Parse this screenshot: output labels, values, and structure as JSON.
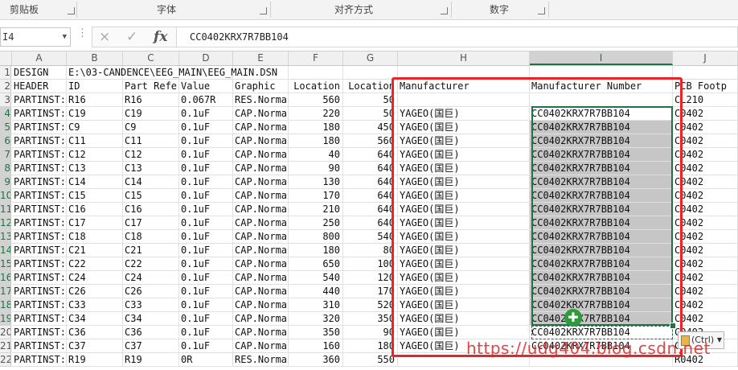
{
  "ribbon": {
    "groups": [
      "剪贴板",
      "字体",
      "对齐方式",
      "数字"
    ]
  },
  "formula_bar": {
    "name_box": "I4",
    "cancel_icon": "×",
    "enter_icon": "✓",
    "fx_label": "fx",
    "formula": "CC0402KRX7R7BB104"
  },
  "columns": [
    "A",
    "B",
    "C",
    "D",
    "E",
    "F",
    "G",
    "H",
    "I",
    "J"
  ],
  "rows": [
    {
      "num": "1",
      "A": "DESIGN",
      "B": "E:\\03-CANDENCE\\EEG_MAIN\\EEG_MAIN.DSN",
      "C": "",
      "D": "",
      "E": "",
      "F": "",
      "G": "",
      "H": "",
      "I": "",
      "J": ""
    },
    {
      "num": "2",
      "A": "HEADER",
      "B": "ID",
      "C": "Part Refe",
      "D": "Value",
      "E": "Graphic",
      "F": "Location",
      "G": "Location",
      "H": "Manufacturer",
      "I": "Manufacturer Number",
      "J": "PCB Footp"
    },
    {
      "num": "3",
      "A": "PARTINST:R16",
      "B": "R16",
      "C": "R16",
      "D": "0.067R",
      "E": "RES.Norma",
      "F": "560",
      "G": "50",
      "H": "",
      "I": "",
      "J": "CL210"
    },
    {
      "num": "4",
      "A": "PARTINST:C19",
      "B": "C19",
      "C": "C19",
      "D": "0.1uF",
      "E": "CAP.Norma",
      "F": "220",
      "G": "50",
      "H": "YAGEO(国巨)",
      "I": "CC0402KRX7R7BB104",
      "J": "C0402"
    },
    {
      "num": "5",
      "A": "PARTINST:C9",
      "B": "C9",
      "C": "C9",
      "D": "0.1uF",
      "E": "CAP.Norma",
      "F": "180",
      "G": "450",
      "H": "YAGEO(国巨)",
      "I": "CC0402KRX7R7BB104",
      "J": "C0402"
    },
    {
      "num": "6",
      "A": "PARTINST:C11",
      "B": "C11",
      "C": "C11",
      "D": "0.1uF",
      "E": "CAP.Norma",
      "F": "180",
      "G": "560",
      "H": "YAGEO(国巨)",
      "I": "CC0402KRX7R7BB104",
      "J": "C0402"
    },
    {
      "num": "7",
      "A": "PARTINST:C12",
      "B": "C12",
      "C": "C12",
      "D": "0.1uF",
      "E": "CAP.Norma",
      "F": "40",
      "G": "640",
      "H": "YAGEO(国巨)",
      "I": "CC0402KRX7R7BB104",
      "J": "C0402"
    },
    {
      "num": "8",
      "A": "PARTINST:C13",
      "B": "C13",
      "C": "C13",
      "D": "0.1uF",
      "E": "CAP.Norma",
      "F": "90",
      "G": "640",
      "H": "YAGEO(国巨)",
      "I": "CC0402KRX7R7BB104",
      "J": "C0402"
    },
    {
      "num": "9",
      "A": "PARTINST:C14",
      "B": "C14",
      "C": "C14",
      "D": "0.1uF",
      "E": "CAP.Norma",
      "F": "130",
      "G": "640",
      "H": "YAGEO(国巨)",
      "I": "CC0402KRX7R7BB104",
      "J": "C0402"
    },
    {
      "num": "10",
      "A": "PARTINST:C15",
      "B": "C15",
      "C": "C15",
      "D": "0.1uF",
      "E": "CAP.Norma",
      "F": "170",
      "G": "640",
      "H": "YAGEO(国巨)",
      "I": "CC0402KRX7R7BB104",
      "J": "C0402"
    },
    {
      "num": "11",
      "A": "PARTINST:C16",
      "B": "C16",
      "C": "C16",
      "D": "0.1uF",
      "E": "CAP.Norma",
      "F": "210",
      "G": "640",
      "H": "YAGEO(国巨)",
      "I": "CC0402KRX7R7BB104",
      "J": "C0402"
    },
    {
      "num": "12",
      "A": "PARTINST:C17",
      "B": "C17",
      "C": "C17",
      "D": "0.1uF",
      "E": "CAP.Norma",
      "F": "250",
      "G": "640",
      "H": "YAGEO(国巨)",
      "I": "CC0402KRX7R7BB104",
      "J": "C0402"
    },
    {
      "num": "13",
      "A": "PARTINST:C18",
      "B": "C18",
      "C": "C18",
      "D": "0.1uF",
      "E": "CAP.Norma",
      "F": "800",
      "G": "540",
      "H": "YAGEO(国巨)",
      "I": "CC0402KRX7R7BB104",
      "J": "C0402"
    },
    {
      "num": "14",
      "A": "PARTINST:C21",
      "B": "C21",
      "C": "C21",
      "D": "0.1uF",
      "E": "CAP.Norma",
      "F": "180",
      "G": "80",
      "H": "YAGEO(国巨)",
      "I": "CC0402KRX7R7BB104",
      "J": "C0402"
    },
    {
      "num": "15",
      "A": "PARTINST:C22",
      "B": "C22",
      "C": "C22",
      "D": "0.1uF",
      "E": "CAP.Norma",
      "F": "650",
      "G": "100",
      "H": "YAGEO(国巨)",
      "I": "CC0402KRX7R7BB104",
      "J": "C0402"
    },
    {
      "num": "16",
      "A": "PARTINST:C24",
      "B": "C24",
      "C": "C24",
      "D": "0.1uF",
      "E": "CAP.Norma",
      "F": "540",
      "G": "120",
      "H": "YAGEO(国巨)",
      "I": "CC0402KRX7R7BB104",
      "J": "C0402"
    },
    {
      "num": "17",
      "A": "PARTINST:C26",
      "B": "C26",
      "C": "C26",
      "D": "0.1uF",
      "E": "CAP.Norma",
      "F": "440",
      "G": "170",
      "H": "YAGEO(国巨)",
      "I": "CC0402KRX7R7BB104",
      "J": "C0402"
    },
    {
      "num": "18",
      "A": "PARTINST:C33",
      "B": "C33",
      "C": "C33",
      "D": "0.1uF",
      "E": "CAP.Norma",
      "F": "310",
      "G": "520",
      "H": "YAGEO(国巨)",
      "I": "CC0402KRX7R7BB104",
      "J": "C0402"
    },
    {
      "num": "19",
      "A": "PARTINST:C34",
      "B": "C34",
      "C": "C34",
      "D": "0.1uF",
      "E": "CAP.Norma",
      "F": "320",
      "G": "350",
      "H": "YAGEO(国巨)",
      "I": "CC0402KRX7R7BB104",
      "J": "C0402"
    },
    {
      "num": "20",
      "A": "PARTINST:C36",
      "B": "C36",
      "C": "C36",
      "D": "0.1uF",
      "E": "CAP.Norma",
      "F": "350",
      "G": "90",
      "H": "YAGEO(国巨)",
      "I": "CC0402KRX7R7BB104",
      "J": "C0402"
    },
    {
      "num": "21",
      "A": "PARTINST:C37",
      "B": "C37",
      "C": "C37",
      "D": "0.1uF",
      "E": "CAP.Norma",
      "F": "160",
      "G": "180",
      "H": "YAGEO(国巨)",
      "I": "CC0402KRX7R7BB104",
      "J": "C0402"
    },
    {
      "num": "22",
      "A": "PARTINST:R19",
      "B": "R19",
      "C": "R19",
      "D": "0R",
      "E": "RES.Norma",
      "F": "360",
      "G": "550",
      "H": "",
      "I": "",
      "J": "R0402"
    }
  ],
  "paste_options": "(Ctrl)",
  "watermark": "https://udg404.blog.csdn.net",
  "colors": {
    "selection_green": "#217346",
    "annotation_red": "#e8262a",
    "selected_fill": "#c6c6c6"
  }
}
